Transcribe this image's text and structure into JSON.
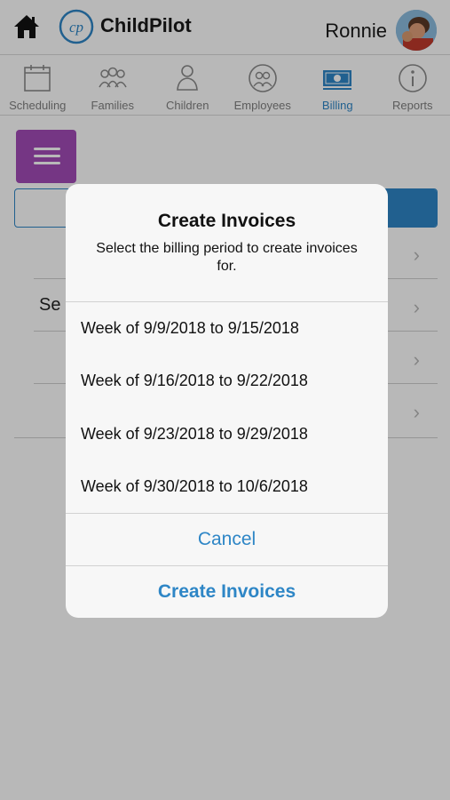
{
  "header": {
    "brand": "ChildPilot",
    "user_name": "Ronnie",
    "home_icon": "home-icon",
    "logo_icon": "childpilot-logo-icon"
  },
  "tabs": [
    {
      "label": "Scheduling",
      "icon": "calendar-icon",
      "active": false
    },
    {
      "label": "Families",
      "icon": "families-icon",
      "active": false
    },
    {
      "label": "Children",
      "icon": "child-icon",
      "active": false
    },
    {
      "label": "Employees",
      "icon": "employees-icon",
      "active": false
    },
    {
      "label": "Billing",
      "icon": "money-icon",
      "active": true
    },
    {
      "label": "Reports",
      "icon": "info-icon",
      "active": false
    }
  ],
  "background": {
    "menu_icon": "hamburger-menu-icon",
    "list_row_partial": "Se"
  },
  "dialog": {
    "title": "Create Invoices",
    "message": "Select the billing period to create invoices for.",
    "periods": [
      "Week of 9/9/2018 to 9/15/2018",
      "Week of 9/16/2018 to 9/22/2018",
      "Week of 9/23/2018 to 9/29/2018",
      "Week of 9/30/2018 to 10/6/2018"
    ],
    "cancel_label": "Cancel",
    "confirm_label": "Create Invoices"
  },
  "colors": {
    "accent": "#2e86c6",
    "menu_button": "#a24bb8"
  }
}
